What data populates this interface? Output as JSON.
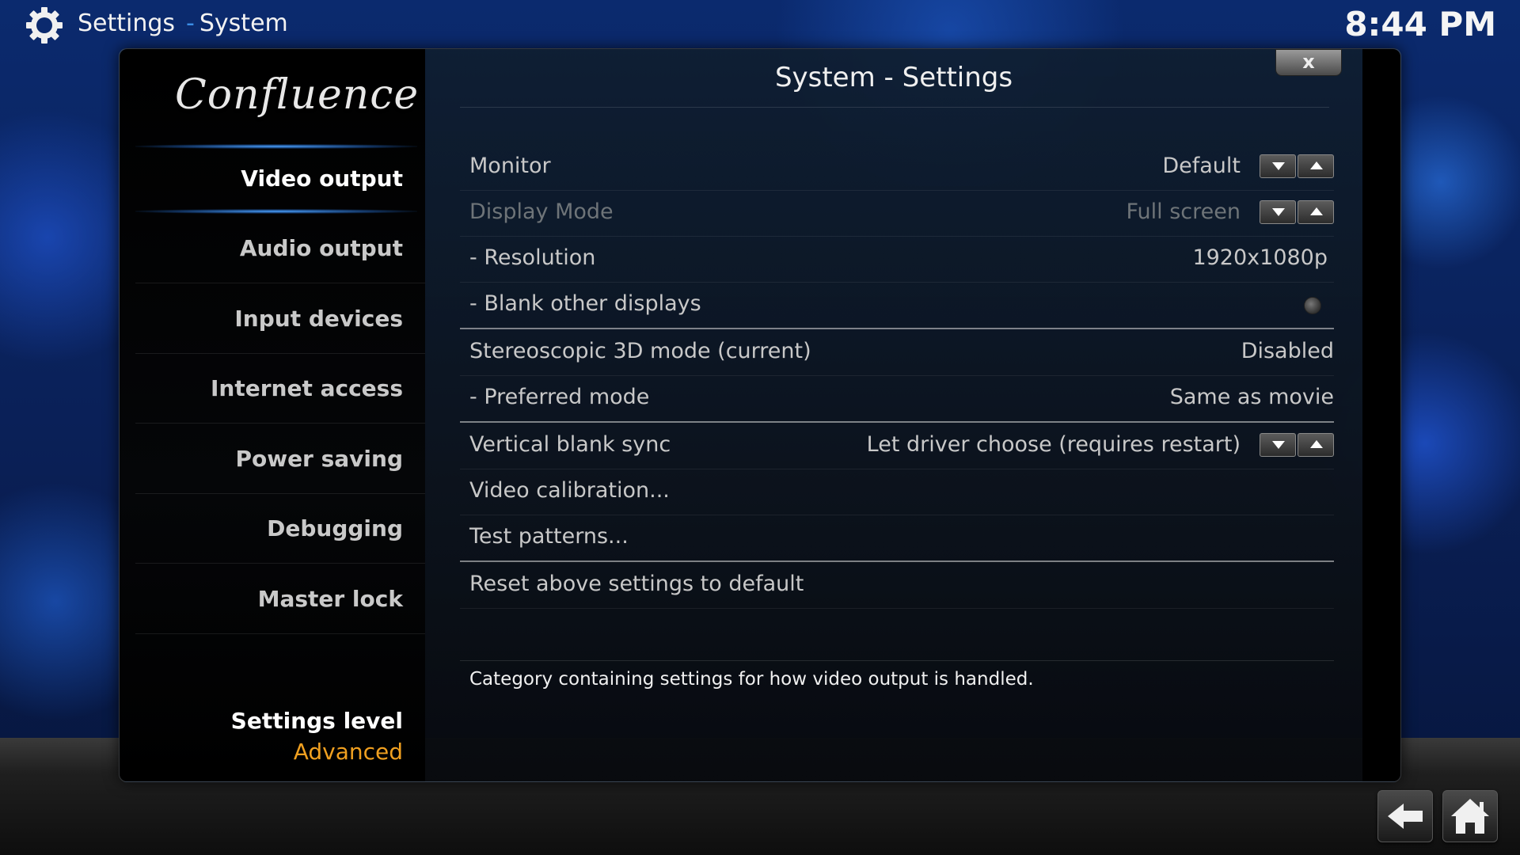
{
  "header": {
    "breadcrumb_root": "Settings",
    "breadcrumb_separator": "-",
    "breadcrumb_current": "System",
    "clock": "8:44 PM"
  },
  "sidebar": {
    "logo": "Confluence",
    "items": [
      {
        "label": "Video output",
        "active": true
      },
      {
        "label": "Audio output"
      },
      {
        "label": "Input devices"
      },
      {
        "label": "Internet access"
      },
      {
        "label": "Power saving"
      },
      {
        "label": "Debugging"
      },
      {
        "label": "Master lock"
      }
    ],
    "settings_level_label": "Settings level",
    "settings_level_value": "Advanced"
  },
  "dialog": {
    "title": "System - Settings",
    "close_label": "x",
    "rows": [
      {
        "label": "Monitor",
        "value": "Default"
      },
      {
        "label": "Display Mode",
        "value": "Full screen"
      },
      {
        "label": "- Resolution",
        "value": "1920x1080p"
      },
      {
        "label": "- Blank other displays",
        "value": ""
      },
      {
        "label": "Stereoscopic 3D mode (current)",
        "value": "Disabled"
      },
      {
        "label": "- Preferred mode",
        "value": "Same as movie"
      },
      {
        "label": "Vertical blank sync",
        "value": "Let driver choose (requires restart)"
      },
      {
        "label": "Video calibration...",
        "value": ""
      },
      {
        "label": "Test patterns...",
        "value": ""
      },
      {
        "label": "Reset above settings to default",
        "value": ""
      }
    ],
    "description": "Category containing settings for how video output is handled."
  },
  "colors": {
    "accent": "#3b8ee6",
    "settings_level_value": "#f0a020"
  }
}
